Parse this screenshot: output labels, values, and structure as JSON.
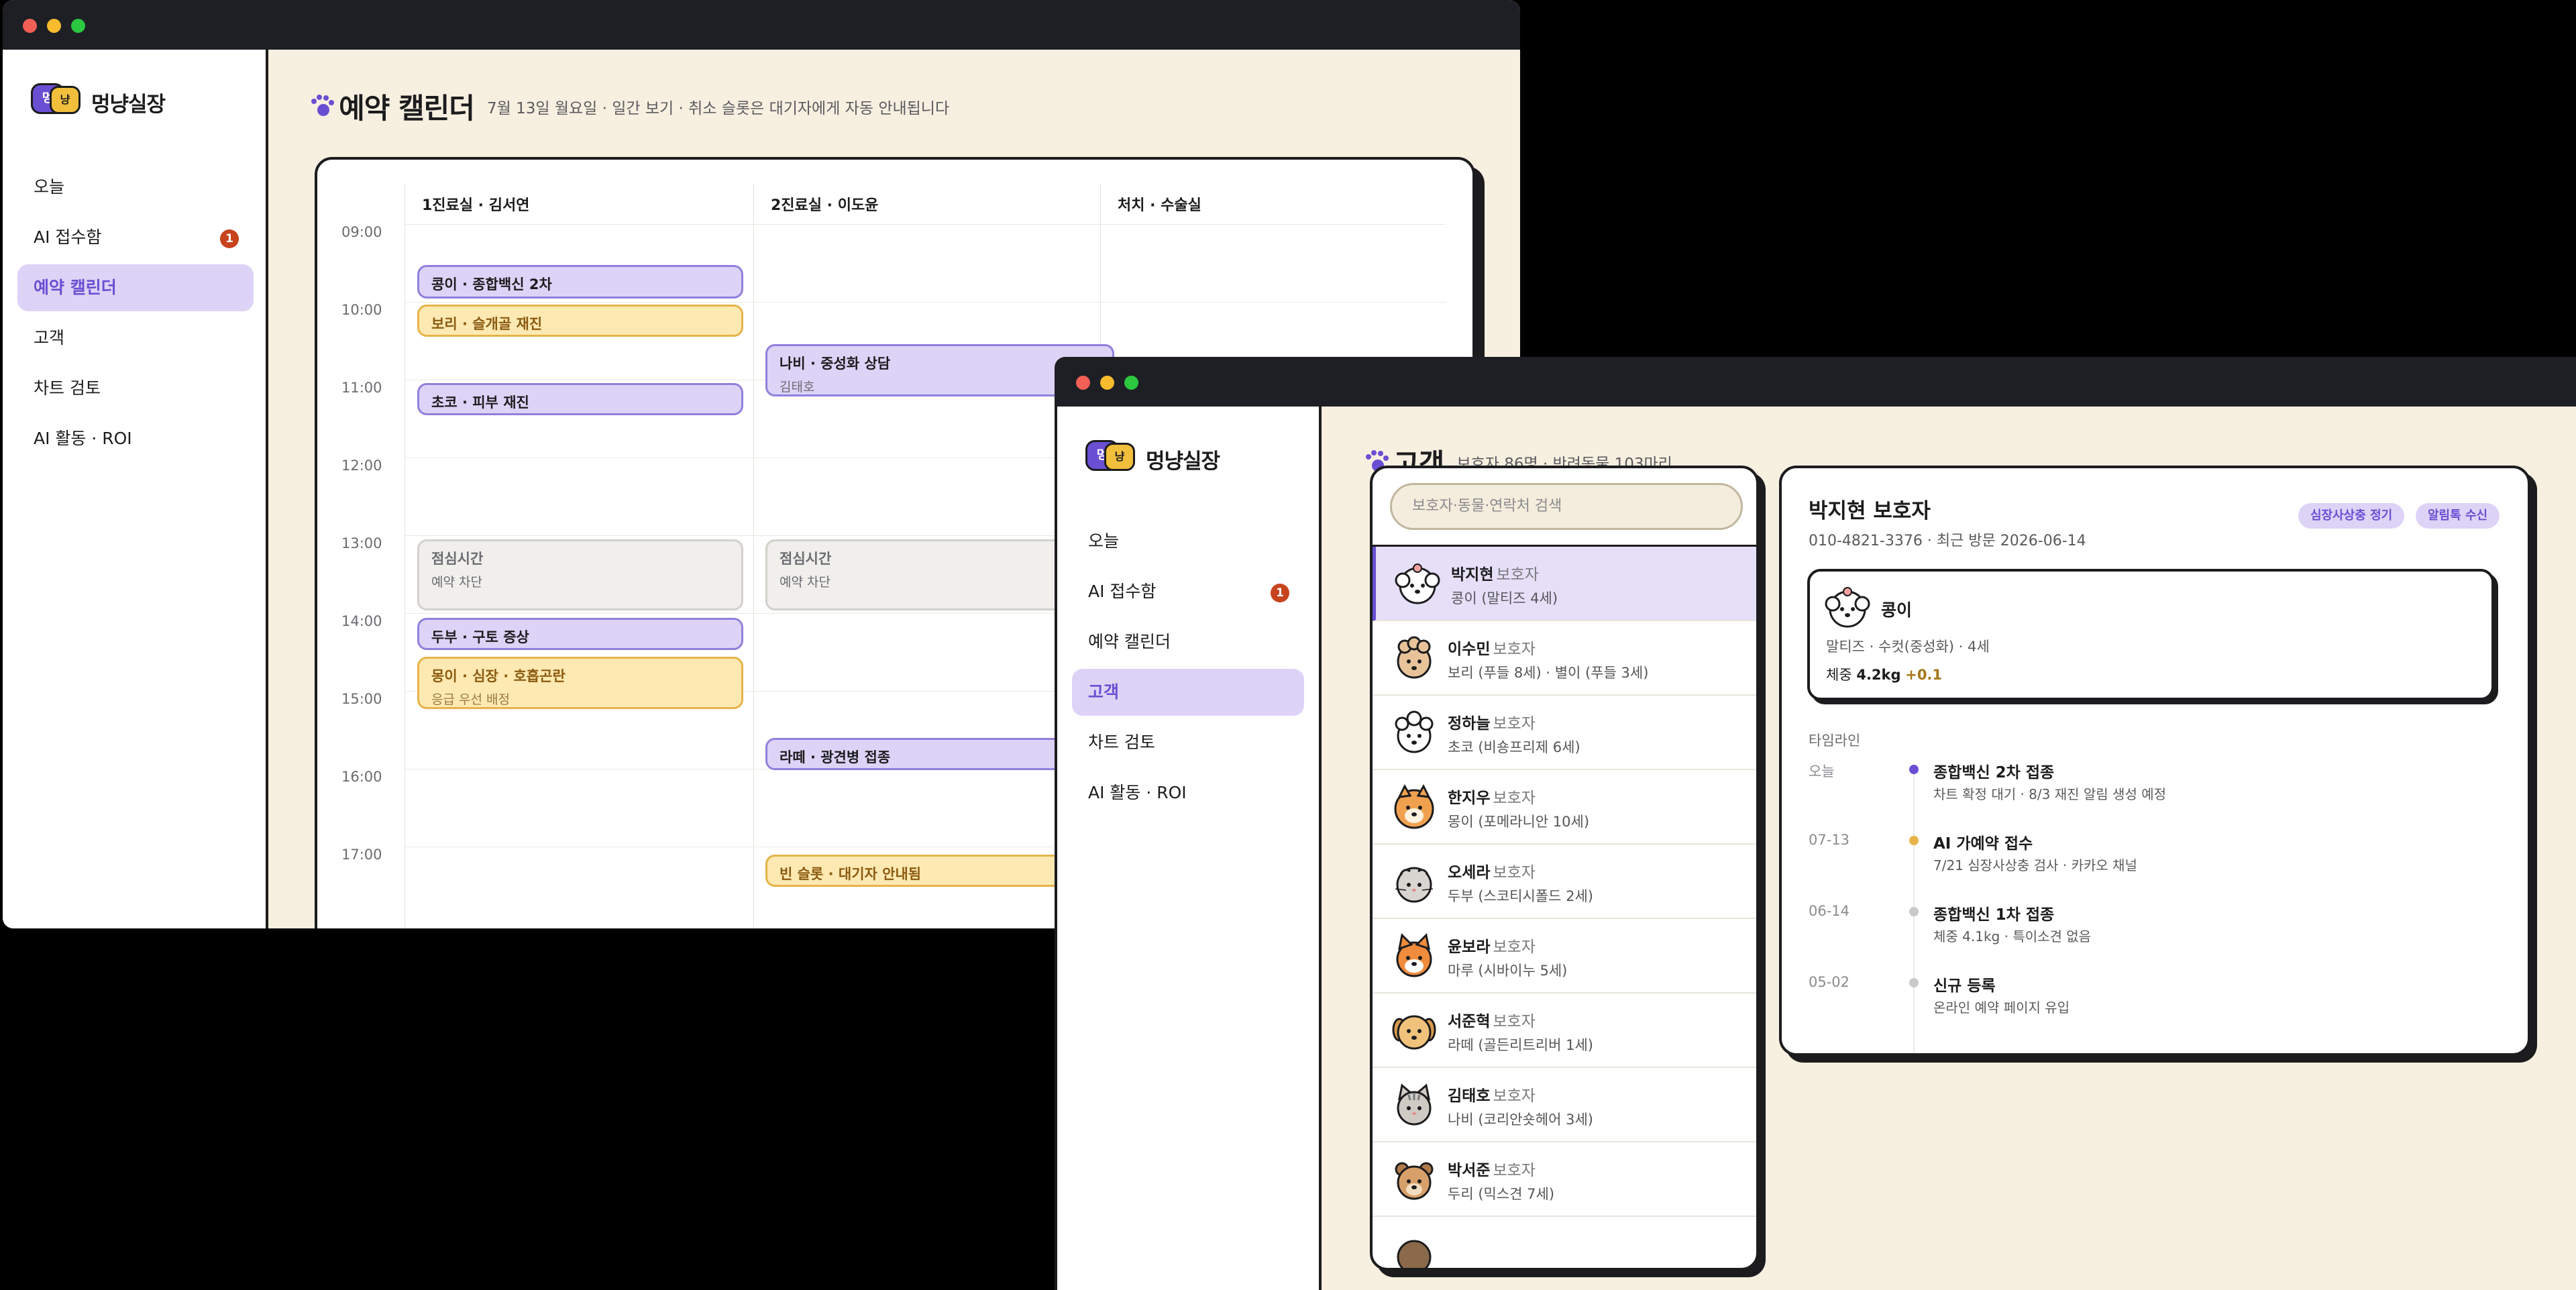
{
  "brand": {
    "name": "멍냥실장",
    "logo_left": "멍",
    "logo_right": "냥"
  },
  "nav": [
    {
      "label": "오늘"
    },
    {
      "label": "AI 접수함",
      "badge": "1"
    },
    {
      "label": "예약 캘린더"
    },
    {
      "label": "고객"
    },
    {
      "label": "차트 검토"
    },
    {
      "label": "AI 활동 · ROI"
    }
  ],
  "calendar_window": {
    "active_nav": "예약 캘린더",
    "title": "예약 캘린더",
    "subtitle": "7월 13일 월요일 · 일간 보기 · 취소 슬롯은 대기자에게 자동 안내됩니다",
    "columns": [
      "1진료실 · 김서연",
      "2진료실 · 이도윤",
      "처치 · 수술실"
    ],
    "times": [
      "09:00",
      "10:00",
      "11:00",
      "12:00",
      "13:00",
      "14:00",
      "15:00",
      "16:00",
      "17:00"
    ],
    "events": [
      {
        "title": "콩이 · 종합백신 2차",
        "sub": "",
        "style": "purple",
        "col": 0
      },
      {
        "title": "보리 · 슬개골 재진",
        "sub": "",
        "style": "yellow",
        "col": 0
      },
      {
        "title": "초코 · 피부 재진",
        "sub": "",
        "style": "purple",
        "col": 0
      },
      {
        "title": "점심시간",
        "sub": "예약 차단",
        "style": "gray",
        "col": 0
      },
      {
        "title": "두부 · 구토 증상",
        "sub": "",
        "style": "purple",
        "col": 0
      },
      {
        "title": "몽이 · 심장 · 호흡곤란",
        "sub": "응급 우선 배정",
        "style": "yellow",
        "col": 0
      },
      {
        "title": "나비 · 중성화 상담",
        "sub": "김태호",
        "style": "purple",
        "col": 1
      },
      {
        "title": "점심시간",
        "sub": "예약 차단",
        "style": "gray",
        "col": 1
      },
      {
        "title": "라떼 · 광견병 접종",
        "sub": "",
        "style": "purple",
        "col": 1
      },
      {
        "title": "빈 슬롯 · 대기자 안내됨",
        "sub": "",
        "style": "yellow",
        "col": 1
      }
    ]
  },
  "customer_window": {
    "active_nav": "고객",
    "title": "고객",
    "subtitle": "보호자 86명 · 반려동물 103마리",
    "search_placeholder": "보호자·동물·연락처 검색",
    "role_label": "보호자",
    "customers": [
      {
        "name": "박지현",
        "pets": "콩이 (말티즈 4세)",
        "avatar": "maltese"
      },
      {
        "name": "이수민",
        "pets": "보리 (푸들 8세) · 별이 (푸들 3세)",
        "avatar": "poodle"
      },
      {
        "name": "정하늘",
        "pets": "초코 (비숑프리제 6세)",
        "avatar": "bichon"
      },
      {
        "name": "한지우",
        "pets": "몽이 (포메라니안 10세)",
        "avatar": "pomeranian"
      },
      {
        "name": "오세라",
        "pets": "두부 (스코티시폴드 2세)",
        "avatar": "scottish-fold"
      },
      {
        "name": "윤보라",
        "pets": "마루 (시바이누 5세)",
        "avatar": "shiba"
      },
      {
        "name": "서준혁",
        "pets": "라떼 (골든리트리버 1세)",
        "avatar": "retriever"
      },
      {
        "name": "김태호",
        "pets": "나비 (코리안숏헤어 3세)",
        "avatar": "tabby-cat"
      },
      {
        "name": "박서준",
        "pets": "두리 (믹스견 7세)",
        "avatar": "mixed-dog"
      }
    ],
    "detail": {
      "name": "박지현 보호자",
      "meta": "010-4821-3376 · 최근 방문 2026-06-14",
      "tags": [
        "심장사상충 정기",
        "알림톡 수신"
      ],
      "pet": {
        "name": "콩이",
        "info": "말티즈 · 수컷(중성화) · 4세",
        "weight_label": "체중",
        "weight": "4.2kg",
        "delta": "+0.1"
      },
      "timeline_label": "타임라인",
      "timeline": [
        {
          "date": "오늘",
          "title": "종합백신 2차 접종",
          "sub": "차트 확정 대기 · 8/3 재진 알림 생성 예정",
          "color": "#6a4fd3"
        },
        {
          "date": "07-13",
          "title": "AI 가예약 접수",
          "sub": "7/21 심장사상충 검사 · 카카오 채널",
          "color": "#e6b44a"
        },
        {
          "date": "06-14",
          "title": "종합백신 1차 접종",
          "sub": "체중 4.1kg · 특이소견 없음",
          "color": "#c9c9cc"
        },
        {
          "date": "05-02",
          "title": "신규 등록",
          "sub": "온라인 예약 페이지 유입",
          "color": "#c9c9cc"
        }
      ]
    }
  },
  "colors": {
    "accent": "#6a4fd3",
    "cream": "#f7efe0",
    "ink": "#1c1c1e",
    "warn": "#c7431d"
  }
}
